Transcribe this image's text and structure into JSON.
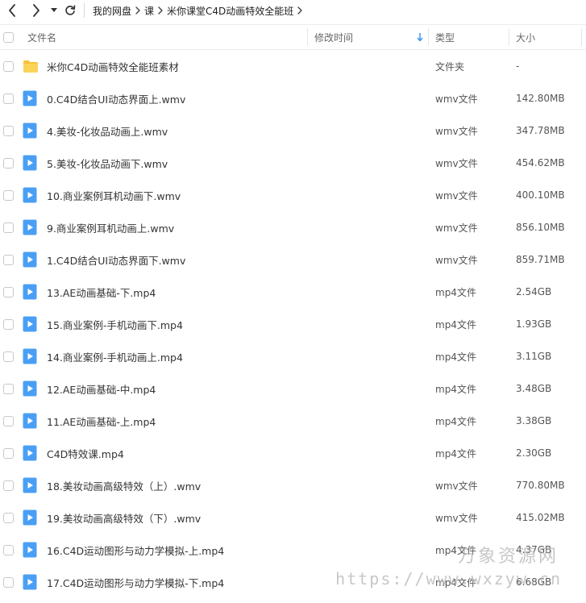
{
  "breadcrumb": {
    "items": [
      "我的网盘",
      "课",
      "米你课堂C4D动画特效全能班"
    ]
  },
  "header": {
    "name_label": "文件名",
    "modified_label": "修改时间",
    "type_label": "类型",
    "size_label": "大小"
  },
  "files": [
    {
      "name": "米你C4D动画特效全能班素材",
      "type": "文件夹",
      "size": "-",
      "icon": "folder-icon"
    },
    {
      "name": "0.C4D结合UI动态界面上.wmv",
      "type": "wmv文件",
      "size": "142.80MB",
      "icon": "video-file-icon"
    },
    {
      "name": "4.美妆-化妆品动画上.wmv",
      "type": "wmv文件",
      "size": "347.78MB",
      "icon": "video-file-icon"
    },
    {
      "name": "5.美妆-化妆品动画下.wmv",
      "type": "wmv文件",
      "size": "454.62MB",
      "icon": "video-file-icon"
    },
    {
      "name": "10.商业案例耳机动画下.wmv",
      "type": "wmv文件",
      "size": "400.10MB",
      "icon": "video-file-icon"
    },
    {
      "name": "9.商业案例耳机动画上.wmv",
      "type": "wmv文件",
      "size": "856.10MB",
      "icon": "video-file-icon"
    },
    {
      "name": "1.C4D结合UI动态界面下.wmv",
      "type": "wmv文件",
      "size": "859.71MB",
      "icon": "video-file-icon"
    },
    {
      "name": "13.AE动画基础-下.mp4",
      "type": "mp4文件",
      "size": "2.54GB",
      "icon": "video-file-icon"
    },
    {
      "name": "15.商业案例-手机动画下.mp4",
      "type": "mp4文件",
      "size": "1.93GB",
      "icon": "video-file-icon"
    },
    {
      "name": "14.商业案例-手机动画上.mp4",
      "type": "mp4文件",
      "size": "3.11GB",
      "icon": "video-file-icon"
    },
    {
      "name": "12.AE动画基础-中.mp4",
      "type": "mp4文件",
      "size": "3.48GB",
      "icon": "video-file-icon"
    },
    {
      "name": "11.AE动画基础-上.mp4",
      "type": "mp4文件",
      "size": "3.38GB",
      "icon": "video-file-icon"
    },
    {
      "name": "C4D特效课.mp4",
      "type": "mp4文件",
      "size": "2.30GB",
      "icon": "video-file-icon"
    },
    {
      "name": "18.美妆动画高级特效（上）.wmv",
      "type": "wmv文件",
      "size": "770.80MB",
      "icon": "video-file-icon"
    },
    {
      "name": "19.美妆动画高级特效（下）.wmv",
      "type": "wmv文件",
      "size": "415.02MB",
      "icon": "video-file-icon"
    },
    {
      "name": "16.C4D运动图形与动力学模拟-上.mp4",
      "type": "mp4文件",
      "size": "4.37GB",
      "icon": "video-file-icon"
    },
    {
      "name": "17.C4D运动图形与动力学模拟-下.mp4",
      "type": "mp4文件",
      "size": "6.68GB",
      "icon": "video-file-icon"
    }
  ],
  "watermark": {
    "line1": "万象资源网",
    "line2": "https://www.wxzyw.cn"
  },
  "colors": {
    "accent": "#3a8ff0",
    "folder": "#f9c23c",
    "video_icon": "#4a9ff5"
  }
}
